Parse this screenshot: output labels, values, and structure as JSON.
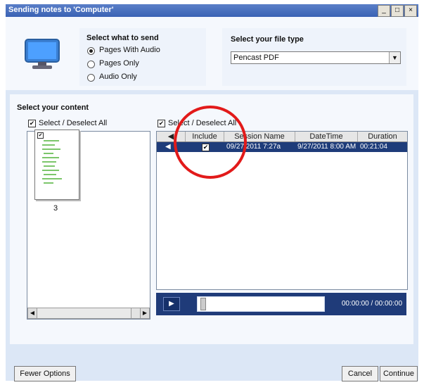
{
  "window": {
    "title": "Sending notes to 'Computer'"
  },
  "send": {
    "heading": "Select what to send",
    "options": [
      "Pages With Audio",
      "Pages Only",
      "Audio Only"
    ],
    "selected_index": 0
  },
  "filetype": {
    "heading": "Select your file type",
    "value": "Pencast PDF"
  },
  "content": {
    "heading": "Select your content"
  },
  "pages": {
    "select_all_label": "Select / Deselect All",
    "page_number": "3"
  },
  "sessions": {
    "select_all_label": "Select / Deselect All",
    "columns": [
      "",
      "Include",
      "Session Name",
      "DateTime",
      "Duration"
    ],
    "rows": [
      {
        "name": "09/27/2011 7:27a",
        "datetime": "9/27/2011 8:00 AM",
        "duration": "00:21:04",
        "include": true
      }
    ]
  },
  "player": {
    "time": "00:00:00 / 00:00:00"
  },
  "footer": {
    "fewer_options": "Fewer Options",
    "cancel": "Cancel",
    "continue": "Continue"
  },
  "colors": {
    "accent": "#1e3c7a",
    "highlight": "#e21a1a",
    "background": "#dce7f6"
  }
}
